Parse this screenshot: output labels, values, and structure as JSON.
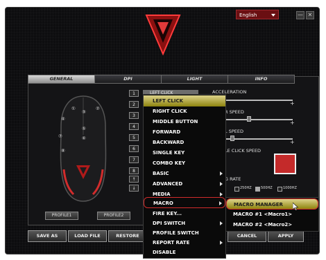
{
  "colors": {
    "accent": "#c42a2a",
    "highlight": "#b8ae2a",
    "background": "#0d0d0f"
  },
  "titlebar": {
    "language": "English",
    "minimize_icon": "minimize-icon",
    "close_icon": "close-icon",
    "minimize": "—",
    "close": "✕"
  },
  "tabs": [
    {
      "label": "GENERAL"
    },
    {
      "label": "DPI"
    },
    {
      "label": "LIGHT"
    },
    {
      "label": "INFO"
    }
  ],
  "mouse_labels": [
    "①",
    "②",
    "③",
    "④",
    "⑤",
    "⑥",
    "⑦",
    "⑧"
  ],
  "buttons": [
    {
      "num": "1",
      "assign": "LEFT CLICK"
    },
    {
      "num": "2",
      "assign": ""
    },
    {
      "num": "3",
      "assign": ""
    },
    {
      "num": "4",
      "assign": ""
    },
    {
      "num": "5",
      "assign": ""
    },
    {
      "num": "6",
      "assign": ""
    },
    {
      "num": "7",
      "assign": ""
    },
    {
      "num": "8",
      "assign": ""
    }
  ],
  "scroll_up": "↑",
  "scroll_down": "↓",
  "settings": {
    "acceleration": "ACCELERATION",
    "pointer_speed": "R SPEED",
    "scroll_speed": "L SPEED",
    "double_click": "LE CLICK SPEED",
    "report_rate": "G RATE",
    "report_options": [
      "250HZ",
      "500HZ",
      "1000HZ"
    ],
    "report_selected": "500HZ"
  },
  "profiles": [
    "PROFILE1",
    "PROFILE2"
  ],
  "bottom_buttons": {
    "save_as": "SAVE AS",
    "load_file": "LOAD FILE",
    "restore": "RESTORE",
    "cancel": "CANCEL",
    "apply": "APPLY"
  },
  "context_menu": [
    {
      "label": "LEFT CLICK",
      "arrow": false,
      "highlighted": true
    },
    {
      "label": "RIGHT CLICK",
      "arrow": false
    },
    {
      "label": "MIDDLE BUTTON",
      "arrow": false
    },
    {
      "label": "FORWARD",
      "arrow": false
    },
    {
      "label": "BACKWARD",
      "arrow": false
    },
    {
      "label": "SINGLE KEY",
      "arrow": false
    },
    {
      "label": "COMBO KEY",
      "arrow": false
    },
    {
      "label": "BASIC",
      "arrow": true
    },
    {
      "label": "ADVANCED",
      "arrow": true
    },
    {
      "label": "MEDIA",
      "arrow": true
    },
    {
      "label": "MACRO",
      "arrow": true,
      "selected": true
    },
    {
      "label": "FIRE KEY...",
      "arrow": false
    },
    {
      "label": "DPI SWITCH",
      "arrow": true
    },
    {
      "label": "PROFILE SWITCH",
      "arrow": false
    },
    {
      "label": "REPORT RATE",
      "arrow": true
    },
    {
      "label": "DISABLE",
      "arrow": false
    }
  ],
  "submenu": [
    {
      "label": "MACRO MANAGER",
      "highlighted": true
    },
    {
      "label": "MACRO #1 <Macro1>"
    },
    {
      "label": "MACRO #2 <Macro2>"
    }
  ]
}
